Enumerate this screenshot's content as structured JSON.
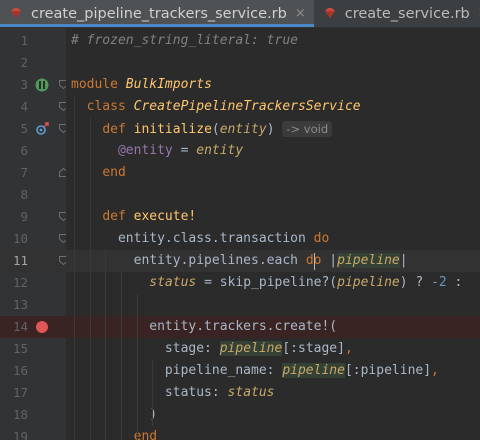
{
  "tabs": [
    {
      "label": "create_pipeline_trackers_service.rb",
      "active": true
    },
    {
      "label": "create_service.rb",
      "active": false
    }
  ],
  "lines": [
    {
      "n": "1",
      "tokens": [
        {
          "c": "cmt",
          "t": "# frozen_string_literal: true"
        }
      ]
    },
    {
      "n": "2",
      "tokens": []
    },
    {
      "n": "3",
      "tokens": [
        {
          "c": "kw",
          "t": "module "
        },
        {
          "c": "cls",
          "t": "BulkImports"
        }
      ]
    },
    {
      "n": "4",
      "tokens": [
        {
          "c": "sym",
          "t": "  "
        },
        {
          "c": "kw",
          "t": "class "
        },
        {
          "c": "cls",
          "t": "CreatePipelineTrackersService"
        }
      ]
    },
    {
      "n": "5",
      "tokens": [
        {
          "c": "sym",
          "t": "    "
        },
        {
          "c": "kw",
          "t": "def "
        },
        {
          "c": "fn",
          "t": "initialize"
        },
        {
          "c": "sym",
          "t": "("
        },
        {
          "c": "param",
          "t": "entity"
        },
        {
          "c": "sym",
          "t": ") "
        },
        {
          "c": "hint",
          "t": "-> void"
        }
      ]
    },
    {
      "n": "6",
      "tokens": [
        {
          "c": "sym",
          "t": "      "
        },
        {
          "c": "ivar",
          "t": "@entity"
        },
        {
          "c": "sym",
          "t": " = "
        },
        {
          "c": "param",
          "t": "entity"
        }
      ]
    },
    {
      "n": "7",
      "tokens": [
        {
          "c": "sym",
          "t": "    "
        },
        {
          "c": "kw",
          "t": "end"
        }
      ]
    },
    {
      "n": "8",
      "tokens": []
    },
    {
      "n": "9",
      "tokens": [
        {
          "c": "sym",
          "t": "    "
        },
        {
          "c": "kw",
          "t": "def "
        },
        {
          "c": "fn",
          "t": "execute!"
        }
      ]
    },
    {
      "n": "10",
      "tokens": [
        {
          "c": "sym",
          "t": "      entity.class.transaction "
        },
        {
          "c": "kw",
          "t": "do"
        }
      ]
    },
    {
      "n": "11",
      "tokens": [
        {
          "c": "sym",
          "t": "        entity.pipelines.each "
        },
        {
          "c": "kw",
          "t": "do"
        },
        {
          "c": "sym",
          "t": " |"
        },
        {
          "c": "param-hl",
          "t": "pipeline"
        },
        {
          "c": "sym",
          "t": "|"
        }
      ]
    },
    {
      "n": "12",
      "tokens": [
        {
          "c": "sym",
          "t": "          "
        },
        {
          "c": "param",
          "t": "status"
        },
        {
          "c": "sym",
          "t": " = skip_pipeline?("
        },
        {
          "c": "param",
          "t": "pipeline"
        },
        {
          "c": "sym",
          "t": ") ? "
        },
        {
          "c": "num",
          "t": "-2"
        },
        {
          "c": "sym",
          "t": " :"
        }
      ]
    },
    {
      "n": "13",
      "tokens": []
    },
    {
      "n": "14",
      "tokens": [
        {
          "c": "sym",
          "t": "          entity.trackers.create!("
        }
      ]
    },
    {
      "n": "15",
      "tokens": [
        {
          "c": "sym",
          "t": "            stage: "
        },
        {
          "c": "param-hl",
          "t": "pipeline"
        },
        {
          "c": "sym",
          "t": "[:stage]"
        },
        {
          "c": "kw",
          "t": ","
        }
      ]
    },
    {
      "n": "16",
      "tokens": [
        {
          "c": "sym",
          "t": "            pipeline_name: "
        },
        {
          "c": "param-hl",
          "t": "pipeline"
        },
        {
          "c": "sym",
          "t": "[:pipeline]"
        },
        {
          "c": "kw",
          "t": ","
        }
      ]
    },
    {
      "n": "17",
      "tokens": [
        {
          "c": "sym",
          "t": "            status: "
        },
        {
          "c": "param",
          "t": "status"
        }
      ]
    },
    {
      "n": "18",
      "tokens": [
        {
          "c": "sym",
          "t": "          )"
        }
      ]
    },
    {
      "n": "19",
      "tokens": [
        {
          "c": "sym",
          "t": "        "
        },
        {
          "c": "kw",
          "t": "end"
        }
      ]
    }
  ],
  "current_line": "11",
  "breakpoint_line": "14",
  "colors": {
    "background": "#2b2b2b",
    "gutter": "#313335",
    "keyword": "#cc7832",
    "method": "#ffc66d",
    "comment": "#808080",
    "ivar": "#9876aa",
    "parameter": "#c8a86a",
    "number": "#6897bb",
    "breakpoint": "#e05555",
    "tab_underline": "#4a88c7"
  },
  "icons": {
    "tab_file": "ruby-file-icon",
    "tab_close": "close-icon",
    "module_marker": "module-gutter-icon",
    "override_marker": "override-gutter-icon",
    "breakpoint": "breakpoint-icon",
    "fold": "fold-icon"
  }
}
